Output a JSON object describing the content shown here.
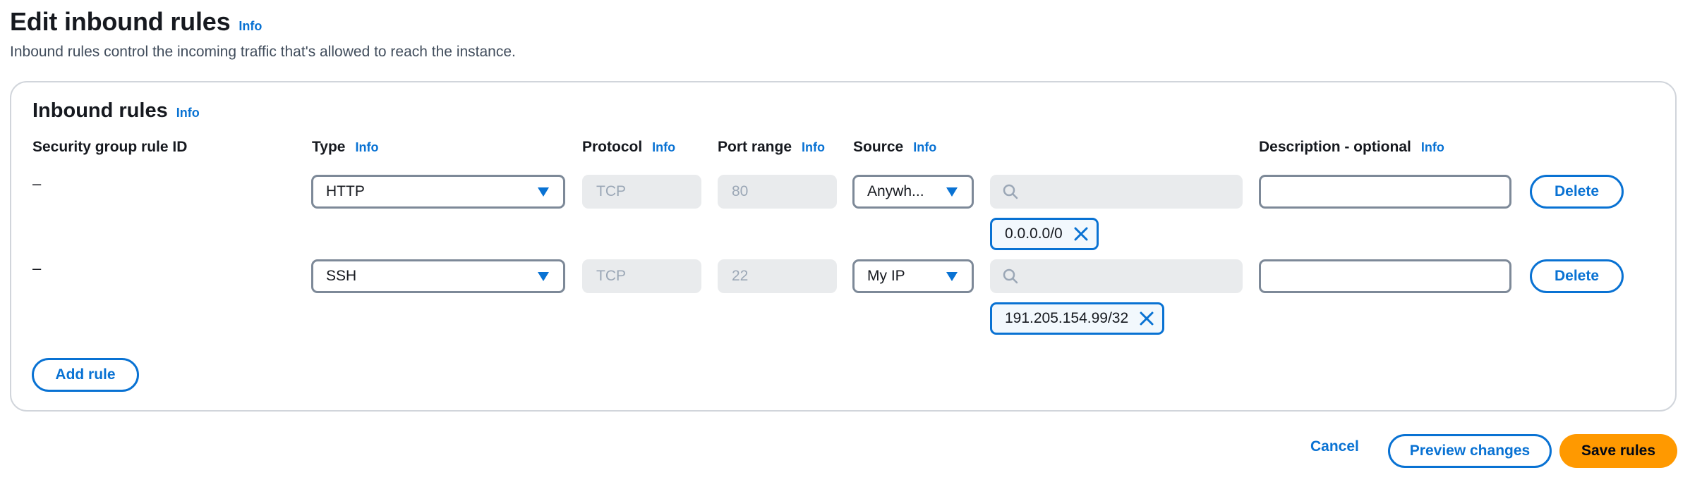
{
  "page": {
    "title": "Edit inbound rules",
    "info_label": "Info",
    "description": "Inbound rules control the incoming traffic that's allowed to reach the instance."
  },
  "panel": {
    "title": "Inbound rules",
    "info_label": "Info",
    "columns": {
      "rule_id": "Security group rule ID",
      "type": "Type",
      "protocol": "Protocol",
      "port_range": "Port range",
      "source": "Source",
      "description": "Description - optional"
    },
    "rules": [
      {
        "rule_id": "–",
        "type": "HTTP",
        "protocol": "TCP",
        "port_range": "80",
        "source": "Anywh...",
        "search_value": "",
        "cidr_token": "0.0.0.0/0",
        "description": "",
        "delete_label": "Delete"
      },
      {
        "rule_id": "–",
        "type": "SSH",
        "protocol": "TCP",
        "port_range": "22",
        "source": "My IP",
        "search_value": "",
        "cidr_token": "191.205.154.99/32",
        "description": "",
        "delete_label": "Delete"
      }
    ],
    "add_rule_label": "Add rule"
  },
  "footer": {
    "cancel_label": "Cancel",
    "preview_label": "Preview changes",
    "save_label": "Save rules"
  },
  "colors": {
    "accent": "#0972d3",
    "primary_button": "#ff9900",
    "disabled_bg": "#e9ebed"
  },
  "icons": {
    "dropdown": "caret-down-icon",
    "search": "search-icon",
    "remove_token": "close-icon"
  }
}
